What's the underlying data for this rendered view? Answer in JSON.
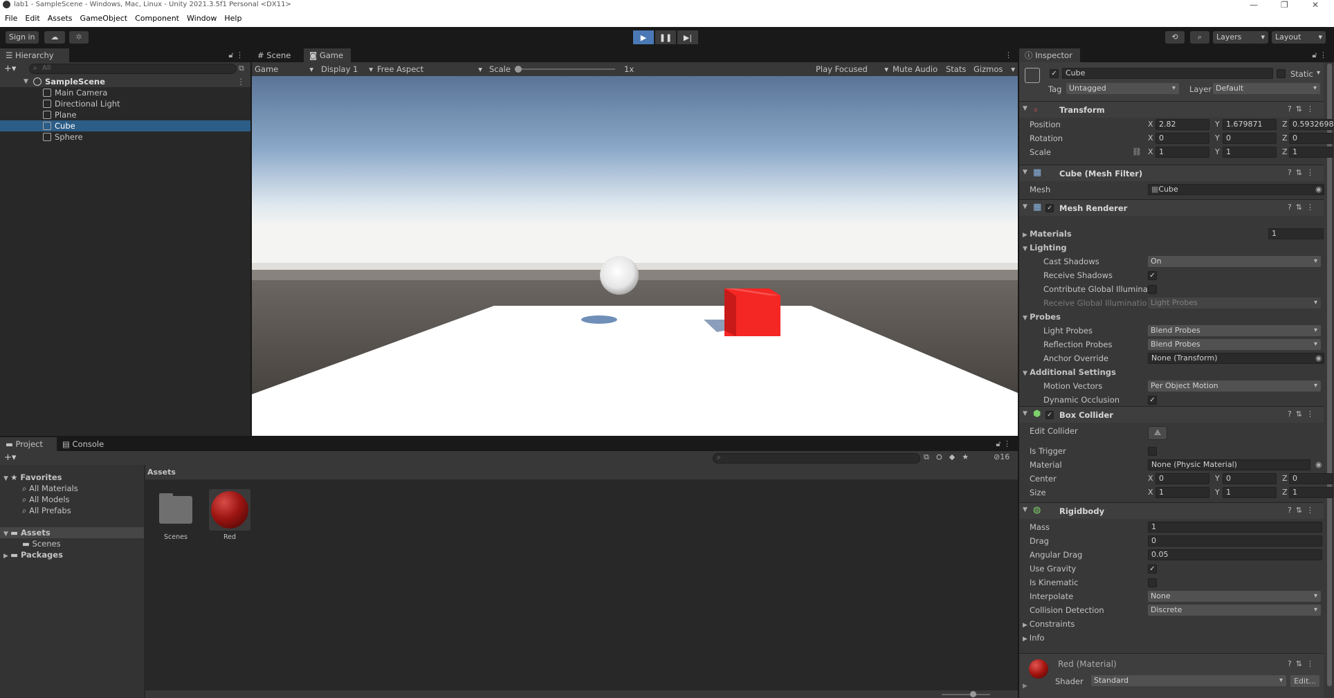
{
  "window": {
    "title": "lab1 - SampleScene - Windows, Mac, Linux - Unity 2021.3.5f1 Personal <DX11>",
    "minimize": "—",
    "restore": "❐",
    "close": "✕"
  },
  "menu": [
    "File",
    "Edit",
    "Assets",
    "GameObject",
    "Component",
    "Window",
    "Help"
  ],
  "toolbar": {
    "sign_in": "Sign in",
    "layers": "Layers",
    "layout": "Layout"
  },
  "hierarchy": {
    "tab": "Hierarchy",
    "search_placeholder": "All",
    "scene": "SampleScene",
    "items": [
      "Main Camera",
      "Directional Light",
      "Plane",
      "Cube",
      "Sphere"
    ],
    "selected": "Cube"
  },
  "game": {
    "tabs": [
      "Scene",
      "Game"
    ],
    "mode": "Game",
    "display": "Display 1",
    "aspect": "Free Aspect",
    "scale_label": "Scale",
    "scale_value": "1x",
    "play_focused": "Play Focused",
    "mute_audio": "Mute Audio",
    "stats": "Stats",
    "gizmos": "Gizmos"
  },
  "project": {
    "tabs": [
      "Project",
      "Console"
    ],
    "favorites_label": "Favorites",
    "favorites": [
      "All Materials",
      "All Models",
      "All Prefabs"
    ],
    "assets_label": "Assets",
    "assets_children": [
      "Scenes"
    ],
    "packages_label": "Packages",
    "breadcrumb": "Assets",
    "grid_items": [
      {
        "name": "Scenes",
        "type": "folder"
      },
      {
        "name": "Red",
        "type": "material"
      }
    ],
    "hidden_count": "16"
  },
  "inspector": {
    "tab": "Inspector",
    "object_name": "Cube",
    "static_label": "Static",
    "tag_label": "Tag",
    "tag_value": "Untagged",
    "layer_label": "Layer",
    "layer_value": "Default",
    "transform": {
      "title": "Transform",
      "position_label": "Position",
      "rotation_label": "Rotation",
      "scale_label": "Scale",
      "position": {
        "x": "2.82",
        "y": "1.679871",
        "z": "0.5932698"
      },
      "rotation": {
        "x": "0",
        "y": "0",
        "z": "0"
      },
      "scale": {
        "x": "1",
        "y": "1",
        "z": "1"
      }
    },
    "mesh_filter": {
      "title": "Cube (Mesh Filter)",
      "mesh_label": "Mesh",
      "mesh_value": "Cube"
    },
    "mesh_renderer": {
      "title": "Mesh Renderer",
      "materials_label": "Materials",
      "materials_count": "1",
      "lighting_label": "Lighting",
      "cast_shadows_label": "Cast Shadows",
      "cast_shadows_value": "On",
      "receive_shadows_label": "Receive Shadows",
      "contribute_gi_label": "Contribute Global Illuminat",
      "receive_gi_label": "Receive Global Illuminatio",
      "receive_gi_value": "Light Probes",
      "probes_label": "Probes",
      "light_probes_label": "Light Probes",
      "light_probes_value": "Blend Probes",
      "reflection_probes_label": "Reflection Probes",
      "reflection_probes_value": "Blend Probes",
      "anchor_override_label": "Anchor Override",
      "anchor_override_value": "None (Transform)",
      "additional_label": "Additional Settings",
      "motion_vectors_label": "Motion Vectors",
      "motion_vectors_value": "Per Object Motion",
      "dynamic_occlusion_label": "Dynamic Occlusion"
    },
    "box_collider": {
      "title": "Box Collider",
      "edit_collider_label": "Edit Collider",
      "is_trigger_label": "Is Trigger",
      "material_label": "Material",
      "material_value": "None (Physic Material)",
      "center_label": "Center",
      "size_label": "Size",
      "center": {
        "x": "0",
        "y": "0",
        "z": "0"
      },
      "size": {
        "x": "1",
        "y": "1",
        "z": "1"
      }
    },
    "rigidbody": {
      "title": "Rigidbody",
      "mass_label": "Mass",
      "mass": "1",
      "drag_label": "Drag",
      "drag": "0",
      "angular_drag_label": "Angular Drag",
      "angular_drag": "0.05",
      "use_gravity_label": "Use Gravity",
      "is_kinematic_label": "Is Kinematic",
      "interpolate_label": "Interpolate",
      "interpolate_value": "None",
      "collision_label": "Collision Detection",
      "collision_value": "Discrete",
      "constraints_label": "Constraints",
      "info_label": "Info"
    },
    "material": {
      "title": "Red (Material)",
      "shader_label": "Shader",
      "shader_value": "Standard",
      "edit_label": "Edit..."
    },
    "axis": {
      "x": "X",
      "y": "Y",
      "z": "Z"
    }
  },
  "colors": {
    "accent_blue": "#4a79b5",
    "selection": "#2c5d87",
    "cube_red": "#e8221f"
  }
}
